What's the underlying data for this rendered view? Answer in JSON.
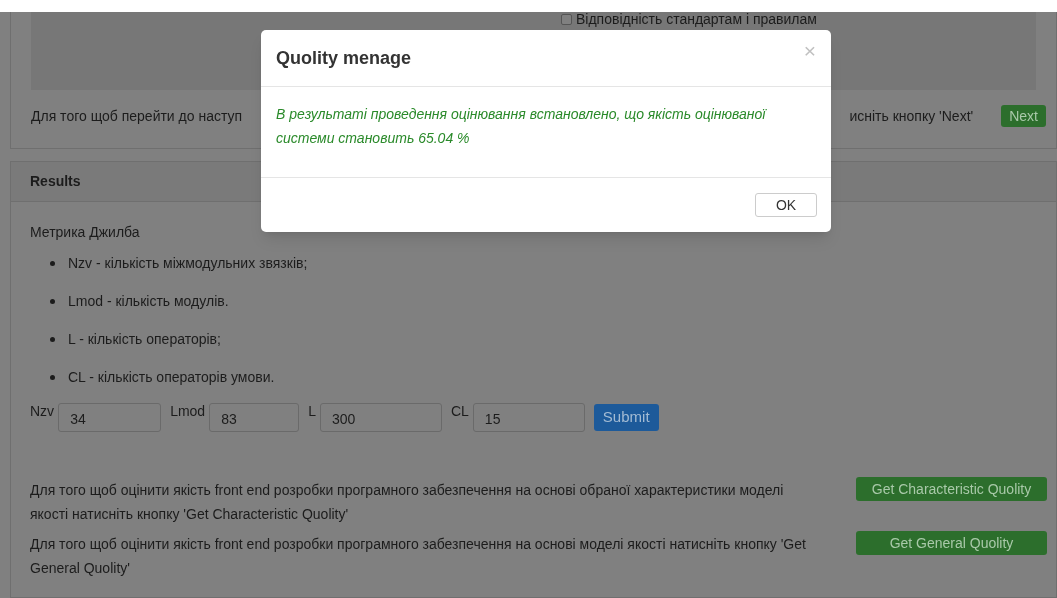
{
  "top_panel": {
    "checkbox": {
      "label": "Відповідність стандартам і правилам",
      "checked": false
    },
    "next_hint_left": "Для того щоб перейти до наступ",
    "next_hint_right": "исніть кнопку 'Next'",
    "next_button": "Next"
  },
  "results": {
    "title": "Results",
    "metric_title": "Метрика Джилба",
    "items": [
      "Nzv - кількість міжмодульних звязків;",
      "Lmod - кількість модулів.",
      "L - кількість операторів;",
      "CL - кількість операторів умови."
    ],
    "fields": [
      {
        "label": "Nzv",
        "value": "34"
      },
      {
        "label": "Lmod",
        "value": "83"
      },
      {
        "label": "L",
        "value": "300"
      },
      {
        "label": "CL",
        "value": "15"
      }
    ],
    "submit": "Submit",
    "actions": [
      {
        "text": "Для того щоб оцінити якість front end розробки програмного забезпечення на основі обраної характеристики моделі якості натисніть кнопку 'Get Characteristic Quolity'",
        "button": "Get Characteristic Quolity"
      },
      {
        "text": "Для того щоб оцінити якість front end розробки програмного забезпечення на основі моделі якості натисніть кнопку 'Get General Quolity'",
        "button": "Get General Quolity"
      }
    ]
  },
  "modal": {
    "title": "Quolity menage",
    "close": "×",
    "message": "В результаті проведення оцінювання встановлено, що якість оцінюваної системи становить 65.04 %",
    "ok": "OK"
  }
}
